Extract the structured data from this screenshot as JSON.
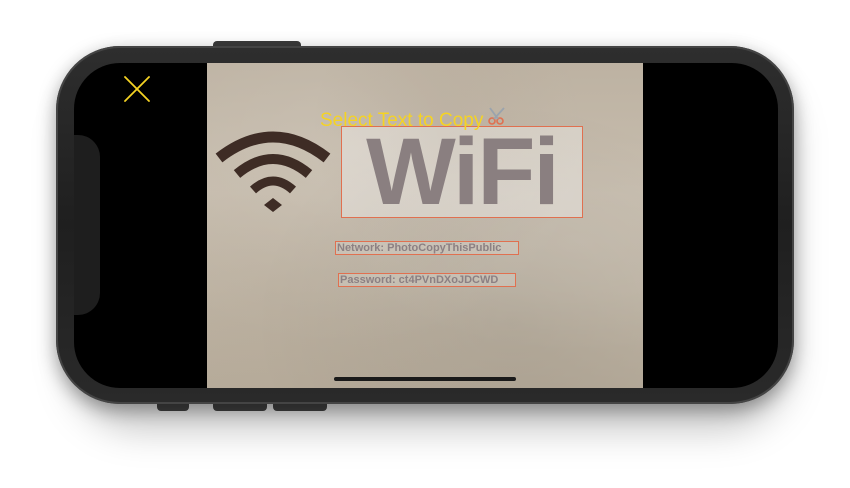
{
  "overlay": {
    "title": "Select Text to Copy",
    "title_icon": "scissors-icon",
    "accent_color": "#f5d323",
    "highlight_color": "#e07050"
  },
  "close_button": {
    "icon": "close-icon"
  },
  "photo": {
    "wifi_symbol": "wifi-icon",
    "headline": "WiFi",
    "network_line": "Network: PhotoCopyThisPublic",
    "password_line": "Password: ct4PVnDXoJDCWD"
  },
  "scissors_glyph": "✂"
}
